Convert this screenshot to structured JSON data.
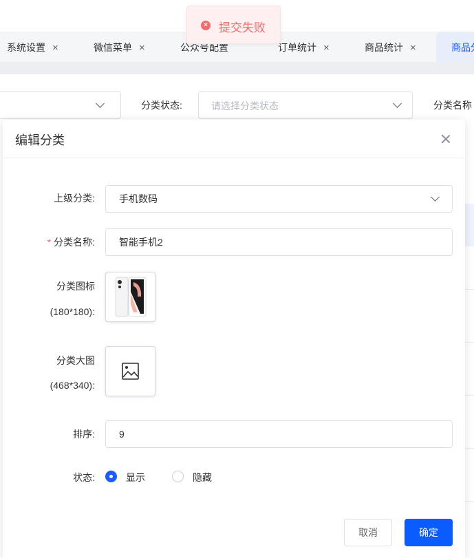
{
  "tabs": [
    {
      "label": "系统设置"
    },
    {
      "label": "微信菜单"
    },
    {
      "label": "公众号配置"
    },
    {
      "label": "订单统计"
    },
    {
      "label": "商品统计"
    },
    {
      "label": "商品分"
    }
  ],
  "tab_close_glyph": "×",
  "filter": {
    "status_label": "分类状态:",
    "status_placeholder": "请选择分类状态",
    "name_label": "分类名称"
  },
  "toast": {
    "icon": "error-icon",
    "message": "提交失败",
    "color": "#f56c6c"
  },
  "dialog": {
    "title": "编辑分类",
    "fields": {
      "parent_label": "上级分类:",
      "parent_value": "手机数码",
      "name_required_mark": "*",
      "name_label": "分类名称:",
      "name_value": "智能手机2",
      "icon_label_line1": "分类图标",
      "icon_label_line2": "(180*180):",
      "banner_label_line1": "分类大图",
      "banner_label_line2": "(468*340):",
      "sort_label": "排序:",
      "sort_value": "9",
      "status_label": "状态:",
      "status_options": [
        {
          "label": "显示",
          "checked": true
        },
        {
          "label": "隐藏",
          "checked": false
        }
      ]
    },
    "buttons": {
      "cancel": "取消",
      "confirm": "确定"
    }
  },
  "colors": {
    "primary": "#1a5cff",
    "error": "#f56c6c"
  }
}
